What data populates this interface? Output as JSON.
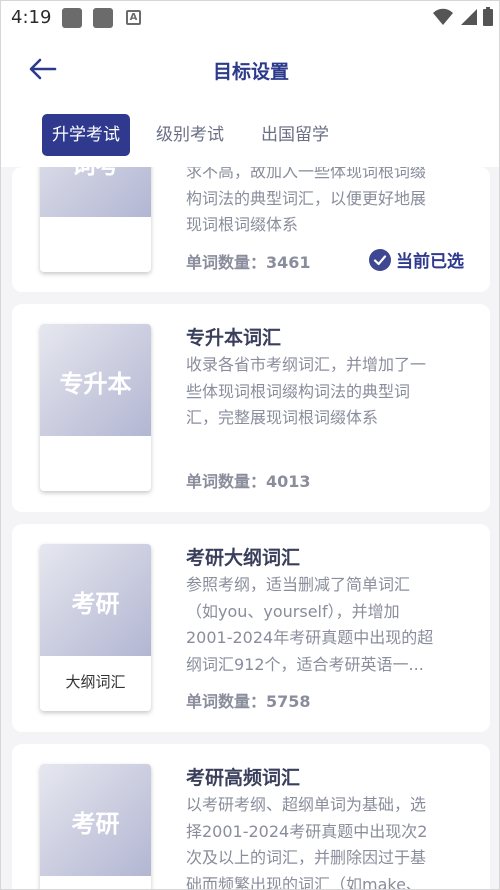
{
  "status_bar": {
    "time": "4:19",
    "icons": [
      "notification-square-icon",
      "notification-square-icon",
      "font-a-icon",
      "wifi-icon",
      "signal-icon",
      "battery-icon"
    ]
  },
  "header": {
    "title": "目标设置",
    "back_icon": "back-arrow-icon"
  },
  "tabs": [
    {
      "label": "升学考试",
      "active": true
    },
    {
      "label": "级别考试",
      "active": false
    },
    {
      "label": "出国留学",
      "active": false
    }
  ],
  "cards": [
    {
      "cover": "词考",
      "name": "",
      "desc_lines": [
        "求不高，故加入一些体现词根词缀",
        "构词法的典型词汇，以便更好地展",
        "现词根词缀体系"
      ],
      "count": "单词数量：3461",
      "selected_label": "当前已选"
    },
    {
      "cover": "专升本",
      "subtitle": "",
      "name": "专升本词汇",
      "desc_lines": [
        "收录各省市考纲词汇，并增加了一",
        "些体现词根词缀构词法的典型词",
        "汇，完整展现词根词缀体系"
      ],
      "count": "单词数量：4013"
    },
    {
      "cover": "考研",
      "subtitle": "大纲词汇",
      "name": "考研大纲词汇",
      "desc_lines": [
        "参照考纲，适当删减了简单词汇",
        "（如you、yourself），并增加",
        "2001-2024年考研真题中出现的超",
        "纲词汇912个，适合考研英语一..."
      ],
      "count": "单词数量：5758"
    },
    {
      "cover": "考研",
      "subtitle": "",
      "name": "考研高频词汇",
      "desc_lines": [
        "以考研考纲、超纲单词为基础，选",
        "择2001-2024考研真题中出现次2",
        "次及以上的词汇，并删除因过于基",
        "础而频繁出现的词汇（如make、"
      ],
      "count": ""
    }
  ],
  "colors": {
    "primary": "#2f3a8e",
    "title": "#2c3a8c",
    "text_gray": "#8a8d9c",
    "background": "#f4f4f6"
  }
}
